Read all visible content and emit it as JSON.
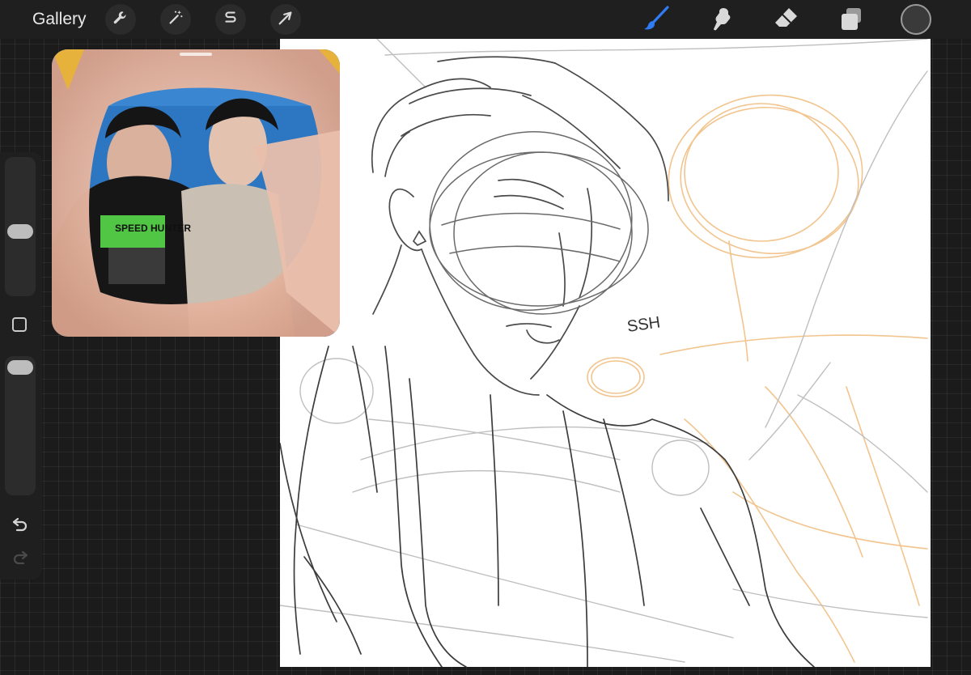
{
  "topbar": {
    "gallery_label": "Gallery",
    "actions": [
      {
        "name": "wrench-icon",
        "label": "Actions"
      },
      {
        "name": "magic-wand-icon",
        "label": "Adjustments"
      },
      {
        "name": "selection-s-icon",
        "label": "Selection"
      },
      {
        "name": "arrow-cursor-icon",
        "label": "Transform"
      }
    ],
    "tools": [
      {
        "name": "brush-icon",
        "active": true
      },
      {
        "name": "smudge-icon",
        "active": false
      },
      {
        "name": "eraser-icon",
        "active": false
      },
      {
        "name": "layers-icon",
        "active": false
      }
    ],
    "current_color": "#3a3a3a",
    "accent_color": "#2f7cf6"
  },
  "sidebar": {
    "brush_size_level": 0.53,
    "opacity_level": 0.04,
    "undo_icon": "undo-icon",
    "redo_icon": "redo-icon"
  },
  "canvas": {
    "sketch_text": "SSH"
  },
  "reference_window": {
    "shirt_text": "SPEED HUNTER"
  }
}
